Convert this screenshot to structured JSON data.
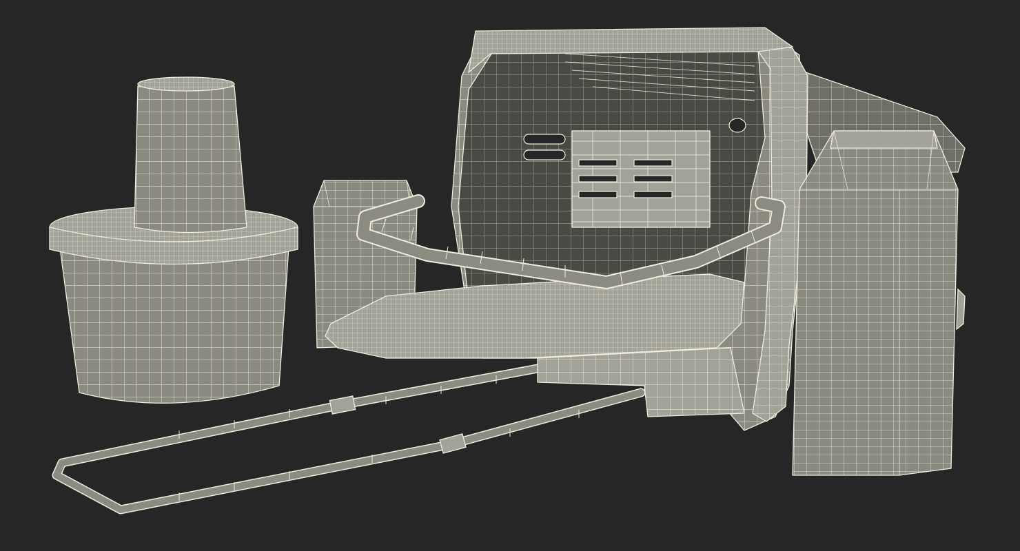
{
  "scene": {
    "background_color": "#262626",
    "wire_color": "#efeede",
    "surface_color": "#8a8a80",
    "objects": [
      "cup",
      "tub",
      "milk-carton-small",
      "pet-carrier",
      "blanket",
      "handle-frame",
      "milk-carton-large"
    ]
  }
}
